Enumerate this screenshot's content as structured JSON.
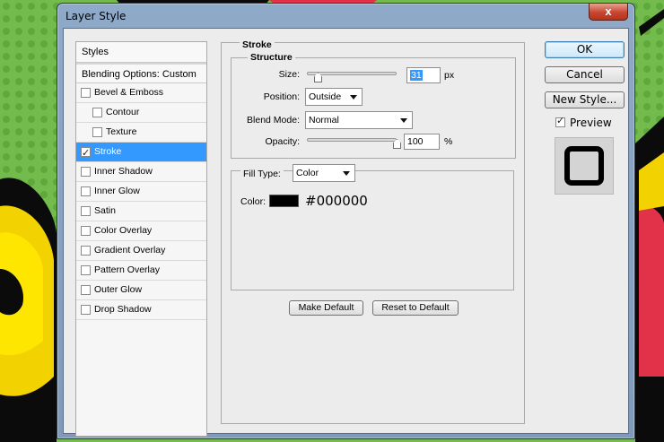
{
  "window": {
    "title": "Layer Style",
    "close_label": "x"
  },
  "styles_panel": {
    "header": "Styles",
    "blending_options": "Blending Options: Custom",
    "items": [
      {
        "label": "Bevel & Emboss",
        "checked": false,
        "indent": false,
        "selected": false
      },
      {
        "label": "Contour",
        "checked": false,
        "indent": true,
        "selected": false
      },
      {
        "label": "Texture",
        "checked": false,
        "indent": true,
        "selected": false
      },
      {
        "label": "Stroke",
        "checked": true,
        "indent": false,
        "selected": true
      },
      {
        "label": "Inner Shadow",
        "checked": false,
        "indent": false,
        "selected": false
      },
      {
        "label": "Inner Glow",
        "checked": false,
        "indent": false,
        "selected": false
      },
      {
        "label": "Satin",
        "checked": false,
        "indent": false,
        "selected": false
      },
      {
        "label": "Color Overlay",
        "checked": false,
        "indent": false,
        "selected": false
      },
      {
        "label": "Gradient Overlay",
        "checked": false,
        "indent": false,
        "selected": false
      },
      {
        "label": "Pattern Overlay",
        "checked": false,
        "indent": false,
        "selected": false
      },
      {
        "label": "Outer Glow",
        "checked": false,
        "indent": false,
        "selected": false
      },
      {
        "label": "Drop Shadow",
        "checked": false,
        "indent": false,
        "selected": false
      }
    ]
  },
  "stroke": {
    "section_title": "Stroke",
    "structure_title": "Structure",
    "size_label": "Size:",
    "size_value": "31",
    "size_unit": "px",
    "size_level": 0.12,
    "position_label": "Position:",
    "position_value": "Outside",
    "blend_mode_label": "Blend Mode:",
    "blend_mode_value": "Normal",
    "opacity_label": "Opacity:",
    "opacity_value": "100",
    "opacity_unit": "%",
    "fill_type_label": "Fill Type:",
    "fill_type_value": "Color",
    "color_label": "Color:",
    "color_value": "#000000",
    "make_default": "Make Default",
    "reset_default": "Reset to Default"
  },
  "actions": {
    "ok": "OK",
    "cancel": "Cancel",
    "new_style": "New Style...",
    "preview_label": "Preview",
    "preview_checked": true
  },
  "colors": {
    "selection": "#3399ff",
    "background_green": "#6fb84a",
    "window_frame": "#8fa9c8"
  }
}
